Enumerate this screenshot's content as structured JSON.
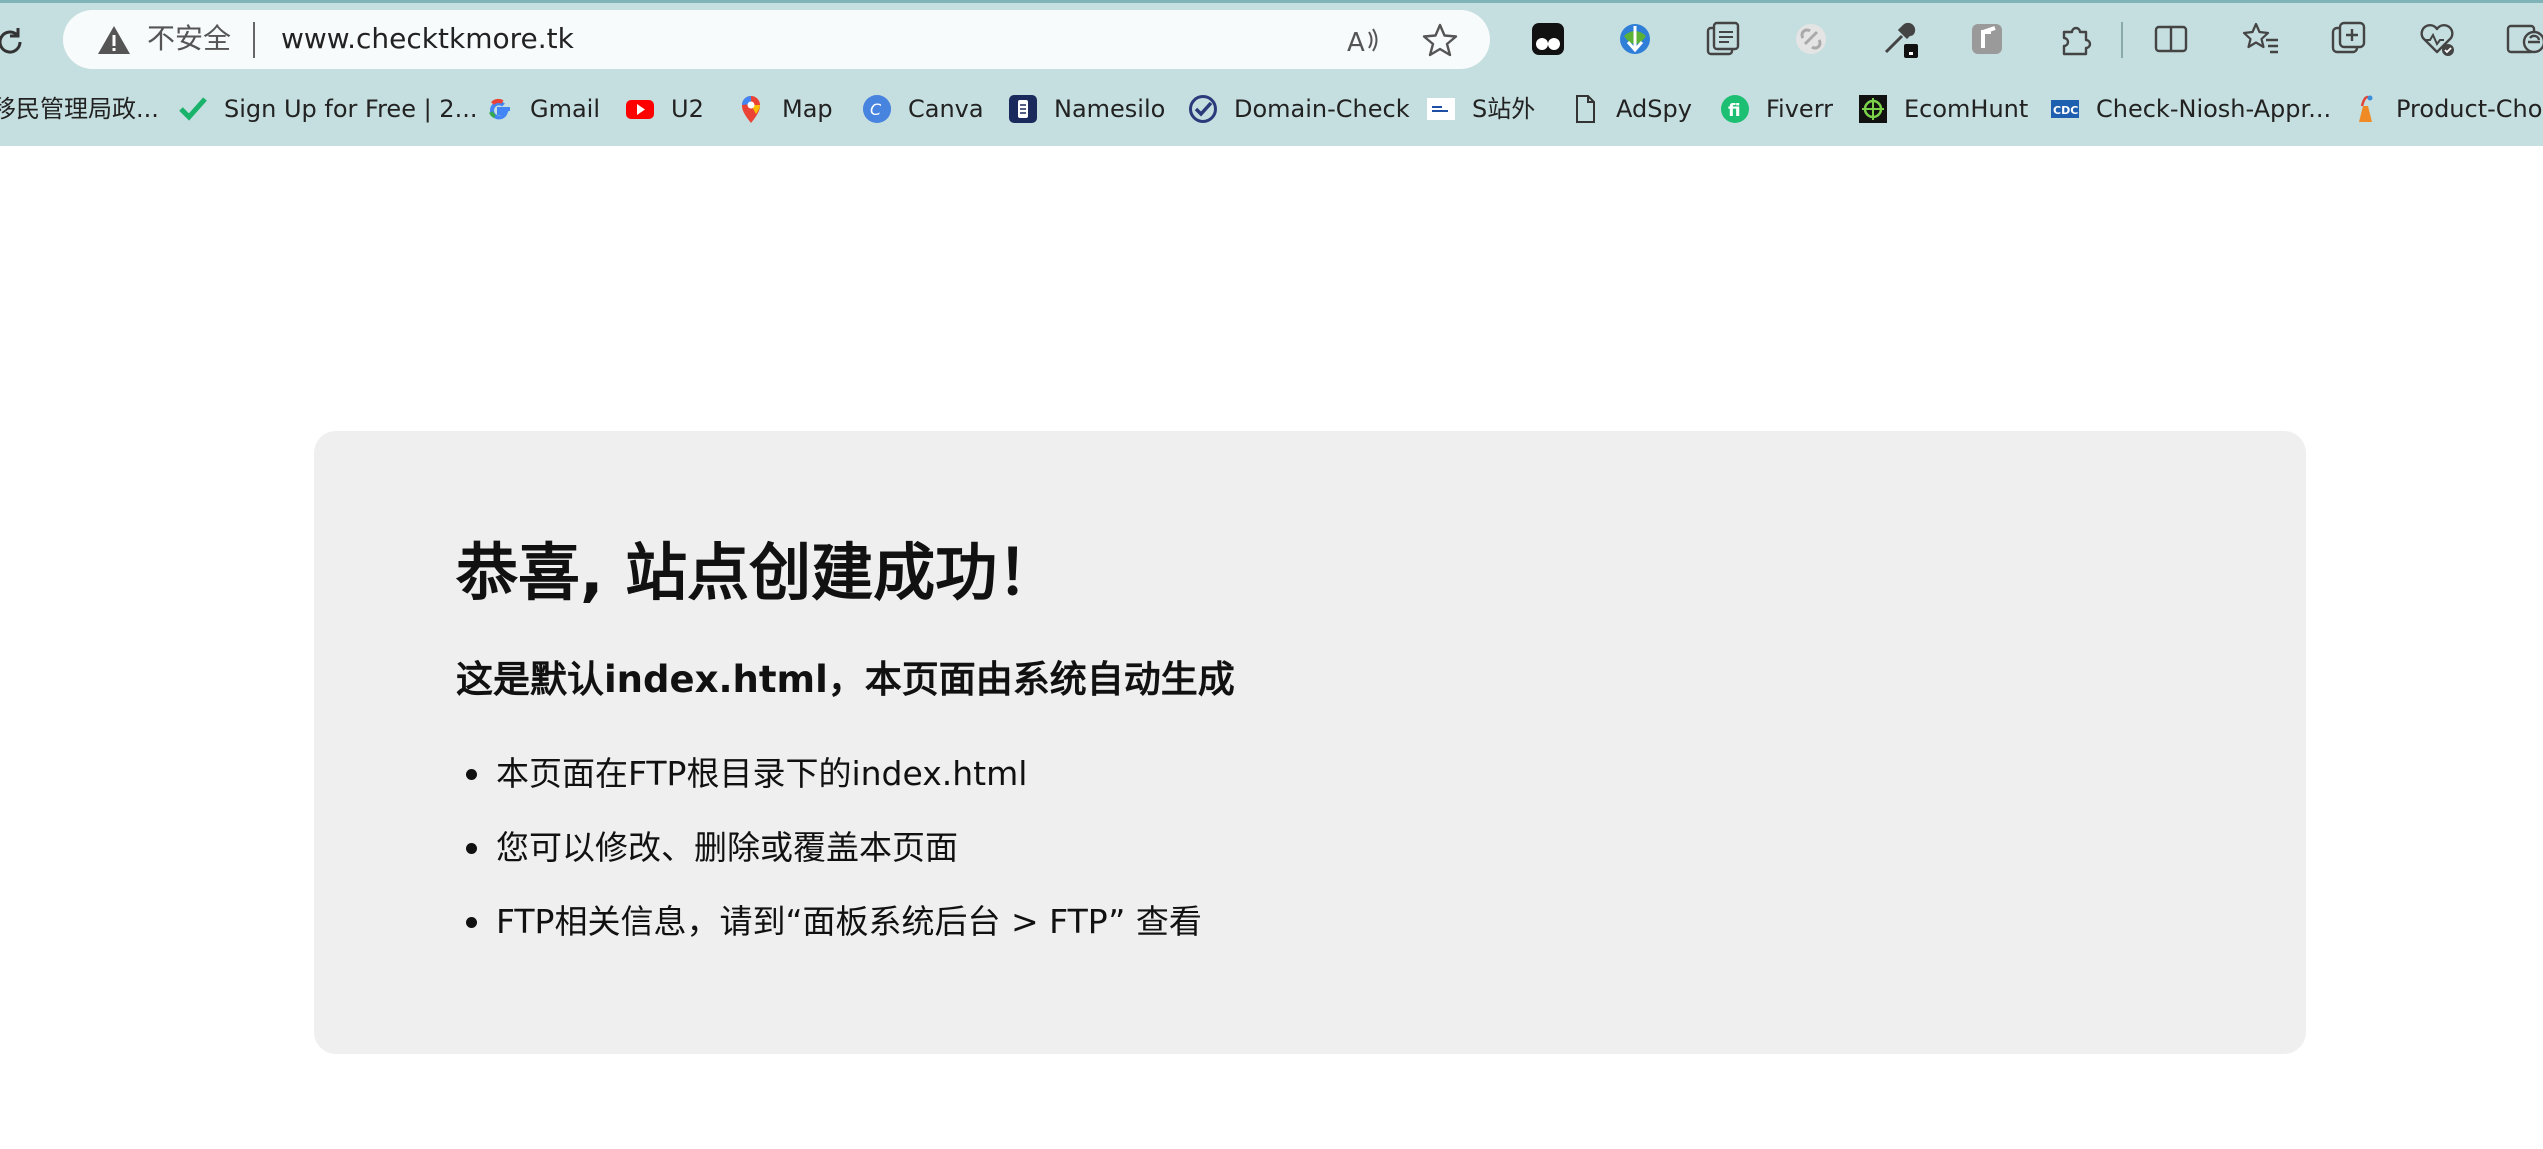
{
  "address_bar": {
    "security_label": "不安全",
    "url": "www.checktkmore.tk"
  },
  "toolbar_icons": [
    "reload-icon",
    "read-aloud-icon",
    "favorite-star-icon",
    "tampermonkey-icon",
    "idm-icon",
    "collections-icon",
    "link-icon",
    "eyedropper-icon",
    "r-extension-icon",
    "extensions-icon",
    "split-screen-icon",
    "favorites-icon",
    "add-tab-icon",
    "browser-essentials-icon",
    "ie-mode-icon"
  ],
  "bookmarks": [
    {
      "label": "移民管理局政...",
      "icon": "gov-icon"
    },
    {
      "label": "Sign Up for Free | 2...",
      "icon": "check-icon"
    },
    {
      "label": "Gmail",
      "icon": "google-icon"
    },
    {
      "label": "U2",
      "icon": "youtube-icon"
    },
    {
      "label": "Map",
      "icon": "map-pin-icon"
    },
    {
      "label": "Canva",
      "icon": "canva-icon"
    },
    {
      "label": "Namesilo",
      "icon": "namesilo-icon"
    },
    {
      "label": "Domain-Check",
      "icon": "domain-check-icon"
    },
    {
      "label": "S站外",
      "icon": "site-icon"
    },
    {
      "label": "AdSpy",
      "icon": "page-icon"
    },
    {
      "label": "Fiverr",
      "icon": "fiverr-icon"
    },
    {
      "label": "EcomHunt",
      "icon": "ecomhunt-icon"
    },
    {
      "label": "Check-Niosh-Appr...",
      "icon": "cdc-icon"
    },
    {
      "label": "Product-Choo",
      "icon": "product-icon"
    }
  ],
  "page": {
    "title": "恭喜, 站点创建成功！",
    "subtitle": "这是默认index.html，本页面由系统自动生成",
    "items": [
      "本页面在FTP根目录下的index.html",
      "您可以修改、删除或覆盖本页面",
      "FTP相关信息，请到“面板系统后台 > FTP” 查看"
    ]
  },
  "colors": {
    "chrome_background": "#c5dedf",
    "card_background": "#efefef",
    "page_background": "#ffffff"
  }
}
